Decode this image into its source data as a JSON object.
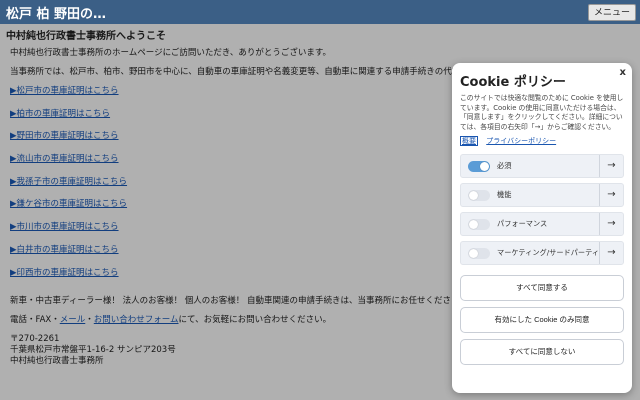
{
  "header": {
    "title": "松戸 柏 野田の…",
    "menu_label": "メニュー"
  },
  "content": {
    "heading": "中村純也行政書士事務所へようこそ",
    "intro": "中村純也行政書士事務所のホームページにご訪問いただき、ありがとうございます。",
    "service": "当事務所では、松戸市、柏市、野田市を中心に、自動車の車庫証明や名義変更等、自動車に関連する申請手続きの代行サービスを行",
    "links": [
      "▶松戸市の車庫証明はこちら",
      "▶柏市の車庫証明はこちら",
      "▶野田市の車庫証明はこちら",
      "▶流山市の車庫証明はこちら",
      "▶我孫子市の車庫証明はこちら",
      "▶鎌ケ谷市の車庫証明はこちら",
      "▶市川市の車庫証明はこちら",
      "▶白井市の車庫証明はこちら",
      "▶印西市の車庫証明はこちら"
    ],
    "dealer": "新車・中古車ディーラー様！ 法人のお客様！ 個人のお客様！ 自動車関連の申請手続きは、当事務所にお任せください。安心・迅速",
    "contact": {
      "prefix": "電話・FAX・",
      "mail": "メール",
      "sep": "・",
      "form": "お問い合わせフォーム",
      "suffix": "にて、お気軽にお問い合わせください。"
    },
    "address": {
      "zip": "〒270-2261",
      "street": "千葉県松戸市常盤平1-16-2 サンピア203号",
      "office": "中村純也行政書士事務所"
    }
  },
  "cookie": {
    "close": "x",
    "title": "Cookie ポリシー",
    "description": "このサイトでは快適な閲覧のために Cookie を使用しています。Cookie の使用に同意いただける場合は、「同意します」をクリックしてください。詳細については、各項目の右矢印「→」からご確認ください。",
    "summary_link": "概要",
    "privacy_link": "プライバシーポリシー",
    "categories": [
      {
        "label": "必須",
        "on": true
      },
      {
        "label": "機能",
        "on": false
      },
      {
        "label": "パフォーマンス",
        "on": false
      },
      {
        "label": "マーケティング/サードパーティ",
        "on": false
      }
    ],
    "arrow": "→",
    "accept_all": "すべて同意する",
    "accept_selected": "有効にした Cookie のみ同意",
    "reject_all": "すべてに同意しない"
  },
  "colors": {
    "header": "#3b5f86",
    "link": "#1a56b0",
    "toggle_on": "#5b9cd6"
  }
}
